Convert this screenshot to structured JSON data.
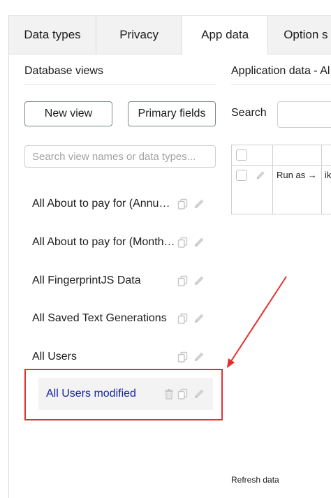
{
  "tabs": [
    {
      "label": "Data types"
    },
    {
      "label": "Privacy"
    },
    {
      "label": "App data"
    },
    {
      "label": "Option s"
    }
  ],
  "left_panel": {
    "title": "Database views",
    "new_view_label": "New view",
    "primary_fields_label": "Primary fields",
    "search_placeholder": "Search view names or data types...",
    "views": [
      {
        "label": "All About to pay for (Annual)s"
      },
      {
        "label": "All About to pay for (Monthly)s"
      },
      {
        "label": "All FingerprintJS Data"
      },
      {
        "label": "All Saved Text Generations"
      },
      {
        "label": "All Users"
      },
      {
        "label": "All Users modified",
        "selected": true
      }
    ]
  },
  "right_panel": {
    "title": "Application data - Al",
    "search_label": "Search",
    "row": {
      "run_as": "Run as →",
      "truncated": "ik"
    },
    "refresh_label": "Refresh data"
  },
  "colors": {
    "annotation": "#e52f2f",
    "selected_text": "#1a24a6"
  },
  "icons": [
    "copy-icon",
    "pencil-icon",
    "trash-icon",
    "checkbox"
  ]
}
